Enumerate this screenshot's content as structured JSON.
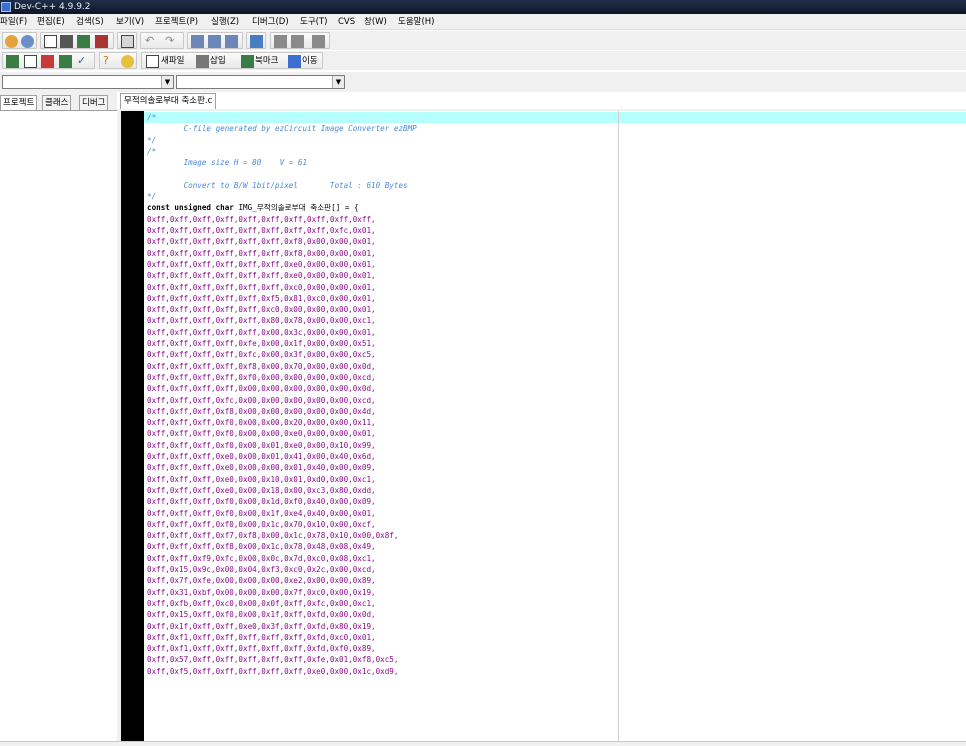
{
  "window": {
    "title": "Dev-C++ 4.9.9.2"
  },
  "menu": [
    "파일(F)",
    "편집(E)",
    "검색(S)",
    "보기(V)",
    "프로젝트(P)",
    "실행(Z)",
    "디버그(D)",
    "도구(T)",
    "CVS",
    "창(W)",
    "도움말(H)"
  ],
  "toolbar": {
    "new_file": "새파일",
    "insert": "삽입",
    "bookmark": "북마크",
    "goto": "이동"
  },
  "left_tabs": [
    "프로젝트",
    "클래스",
    "디버그"
  ],
  "editor": {
    "tab": "무적의솔로부대 축소판.c",
    "comment_lines": [
      "/*",
      "        C-file generated by ezCircuit Image Converter ezBMP",
      "*/",
      "/*",
      "        Image size H = 80    V = 61",
      "",
      "        Convert to B/W 1bit/pixel       Total : 610 Bytes",
      "*/"
    ],
    "decl_keyword": "const unsigned char",
    "decl_rest": " IMG_무적의솔로부대 축소판[] = {",
    "data_lines": [
      "0xff,0xff,0xff,0xff,0xff,0xff,0xff,0xff,0xff,0xff,",
      "0xff,0xff,0xff,0xff,0xff,0xff,0xff,0xff,0xfc,0x01,",
      "0xff,0xff,0xff,0xff,0xff,0xff,0xf8,0x00,0x00,0x01,",
      "0xff,0xff,0xff,0xff,0xff,0xff,0xf8,0x00,0x00,0x01,",
      "0xff,0xff,0xff,0xff,0xff,0xff,0xe0,0x00,0x00,0x01,",
      "0xff,0xff,0xff,0xff,0xff,0xff,0xe0,0x00,0x00,0x01,",
      "0xff,0xff,0xff,0xff,0xff,0xff,0xc0,0x00,0x00,0x01,",
      "0xff,0xff,0xff,0xff,0xff,0xf5,0x81,0xc0,0x00,0x01,",
      "0xff,0xff,0xff,0xff,0xff,0xc0,0x00,0x00,0x00,0x01,",
      "0xff,0xff,0xff,0xff,0xff,0x80,0x78,0x00,0x00,0xc1,",
      "0xff,0xff,0xff,0xff,0xff,0x00,0x3c,0x00,0x00,0x01,",
      "0xff,0xff,0xff,0xff,0xfe,0x00,0x1f,0x00,0x00,0x51,",
      "0xff,0xff,0xff,0xff,0xfc,0x00,0x3f,0x00,0x00,0xc5,",
      "0xff,0xff,0xff,0xff,0xf8,0x00,0x70,0x00,0x00,0x0d,",
      "0xff,0xff,0xff,0xff,0xf0,0x00,0x00,0x00,0x00,0xcd,",
      "0xff,0xff,0xff,0xff,0x00,0x00,0x00,0x00,0x00,0x0d,",
      "0xff,0xff,0xff,0xfc,0x00,0x00,0x00,0x00,0x00,0xcd,",
      "0xff,0xff,0xff,0xf8,0x00,0x00,0x00,0x00,0x00,0x4d,",
      "0xff,0xff,0xff,0xf0,0x00,0x00,0x20,0x00,0x00,0x11,",
      "0xff,0xff,0xff,0xf0,0x00,0x00,0xe0,0x00,0x00,0x01,",
      "0xff,0xff,0xff,0xf0,0x00,0x01,0xe0,0x00,0x10,0x99,",
      "0xff,0xff,0xff,0xe0,0x00,0x01,0x41,0x00,0x40,0x6d,",
      "0xff,0xff,0xff,0xe0,0x00,0x00,0x01,0x40,0x00,0x09,",
      "0xff,0xff,0xff,0xe0,0x00,0x10,0x01,0xd0,0x00,0xc1,",
      "0xff,0xff,0xff,0xe0,0x00,0x18,0x00,0xc3,0x80,0xdd,",
      "0xff,0xff,0xff,0xf0,0x00,0x1d,0xf0,0x40,0x00,0x09,",
      "0xff,0xff,0xff,0xf0,0x00,0x1f,0xe4,0x40,0x00,0x01,",
      "0xff,0xff,0xff,0xf0,0x00,0x1c,0x70,0x10,0x00,0xcf,",
      "0xff,0xff,0xff,0xf7,0xf8,0x00,0x1c,0x78,0x10,0x00,0x8f,",
      "0xff,0xff,0xff,0xf8,0x00,0x1c,0x78,0x48,0x08,0x49,",
      "0xff,0xff,0xf9,0xfc,0x00,0x0c,0x7d,0xc0,0x08,0xc1,",
      "0xff,0x15,0x9c,0x00,0x04,0xf3,0xc0,0x2c,0x00,0xcd,",
      "0xff,0x7f,0xfe,0x00,0x00,0x00,0xe2,0x00,0x00,0x89,",
      "0xff,0x31,0xbf,0x00,0x00,0x00,0x7f,0xc0,0x00,0x19,",
      "0xff,0xfb,0xff,0xc0,0x00,0x0f,0xff,0xfc,0x00,0xc1,",
      "0xff,0x15,0xff,0xf0,0x00,0x1f,0xff,0xfd,0x00,0x0d,",
      "0xff,0x1f,0xff,0xff,0xe0,0x3f,0xff,0xfd,0x80,0x19,",
      "0xff,0xf1,0xff,0xff,0xff,0xff,0xff,0xfd,0xc0,0x01,",
      "0xff,0xf1,0xff,0xff,0xff,0xff,0xff,0xfd,0xf0,0x89,",
      "0xff,0x57,0xff,0xff,0xff,0xff,0xff,0xfe,0x01,0xf8,0xc5,",
      "0xff,0xf5,0xff,0xff,0xff,0xff,0xff,0xe0,0x00,0x1c,0xd9,"
    ]
  }
}
